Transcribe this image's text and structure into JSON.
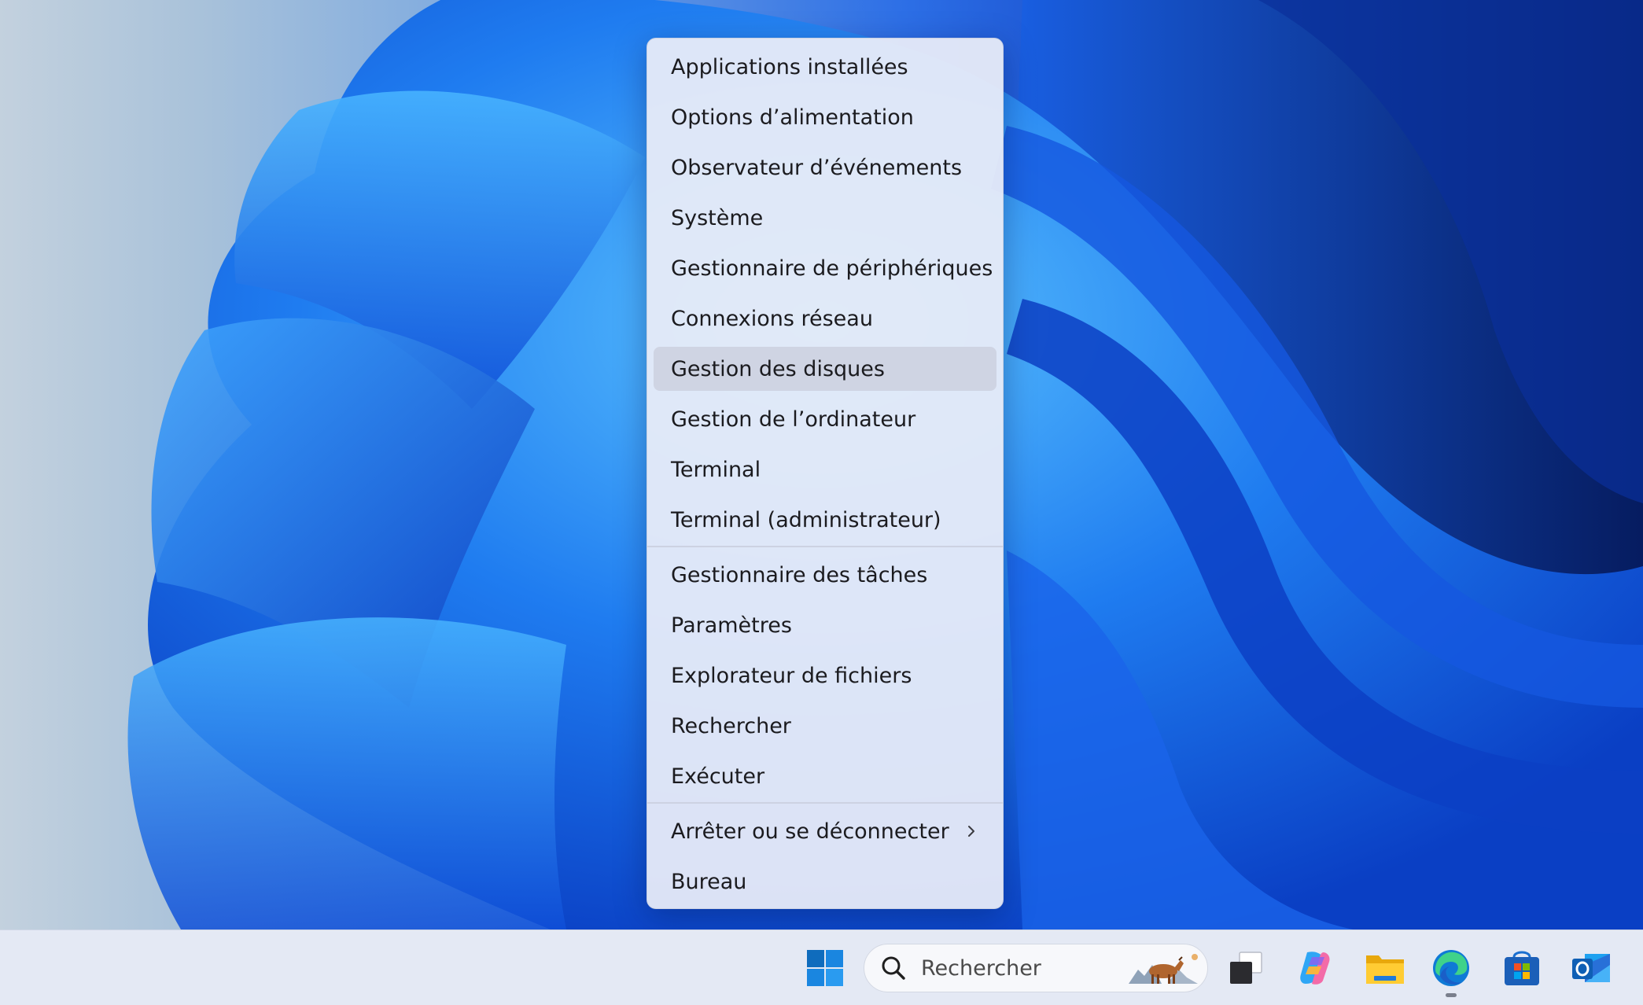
{
  "menu": {
    "items": [
      {
        "label": "Applications installées"
      },
      {
        "label": "Options d’alimentation"
      },
      {
        "label": "Observateur d’événements"
      },
      {
        "label": "Système"
      },
      {
        "label": "Gestionnaire de périphériques"
      },
      {
        "label": "Connexions réseau"
      },
      {
        "label": "Gestion des disques"
      },
      {
        "label": "Gestion de l’ordinateur"
      },
      {
        "label": "Terminal"
      },
      {
        "label": "Terminal (administrateur)"
      },
      {
        "label": "Gestionnaire des tâches"
      },
      {
        "label": "Paramètres"
      },
      {
        "label": "Explorateur de fichiers"
      },
      {
        "label": "Rechercher"
      },
      {
        "label": "Exécuter"
      },
      {
        "label": "Arrêter ou se déconnecter",
        "has_submenu": true
      },
      {
        "label": "Bureau"
      }
    ],
    "hovered_item": "Gestion des disques"
  },
  "taskbar": {
    "search": {
      "placeholder": "Rechercher"
    },
    "icons": [
      "windows-start-icon",
      "task-view-icon",
      "copilot-icon",
      "file-explorer-icon",
      "edge-icon",
      "microsoft-store-icon",
      "outlook-icon"
    ]
  },
  "colors": {
    "accent": "#0078d4",
    "menu_bg": "#e9ecf8",
    "taskbar_bg": "#e4e9f4"
  }
}
